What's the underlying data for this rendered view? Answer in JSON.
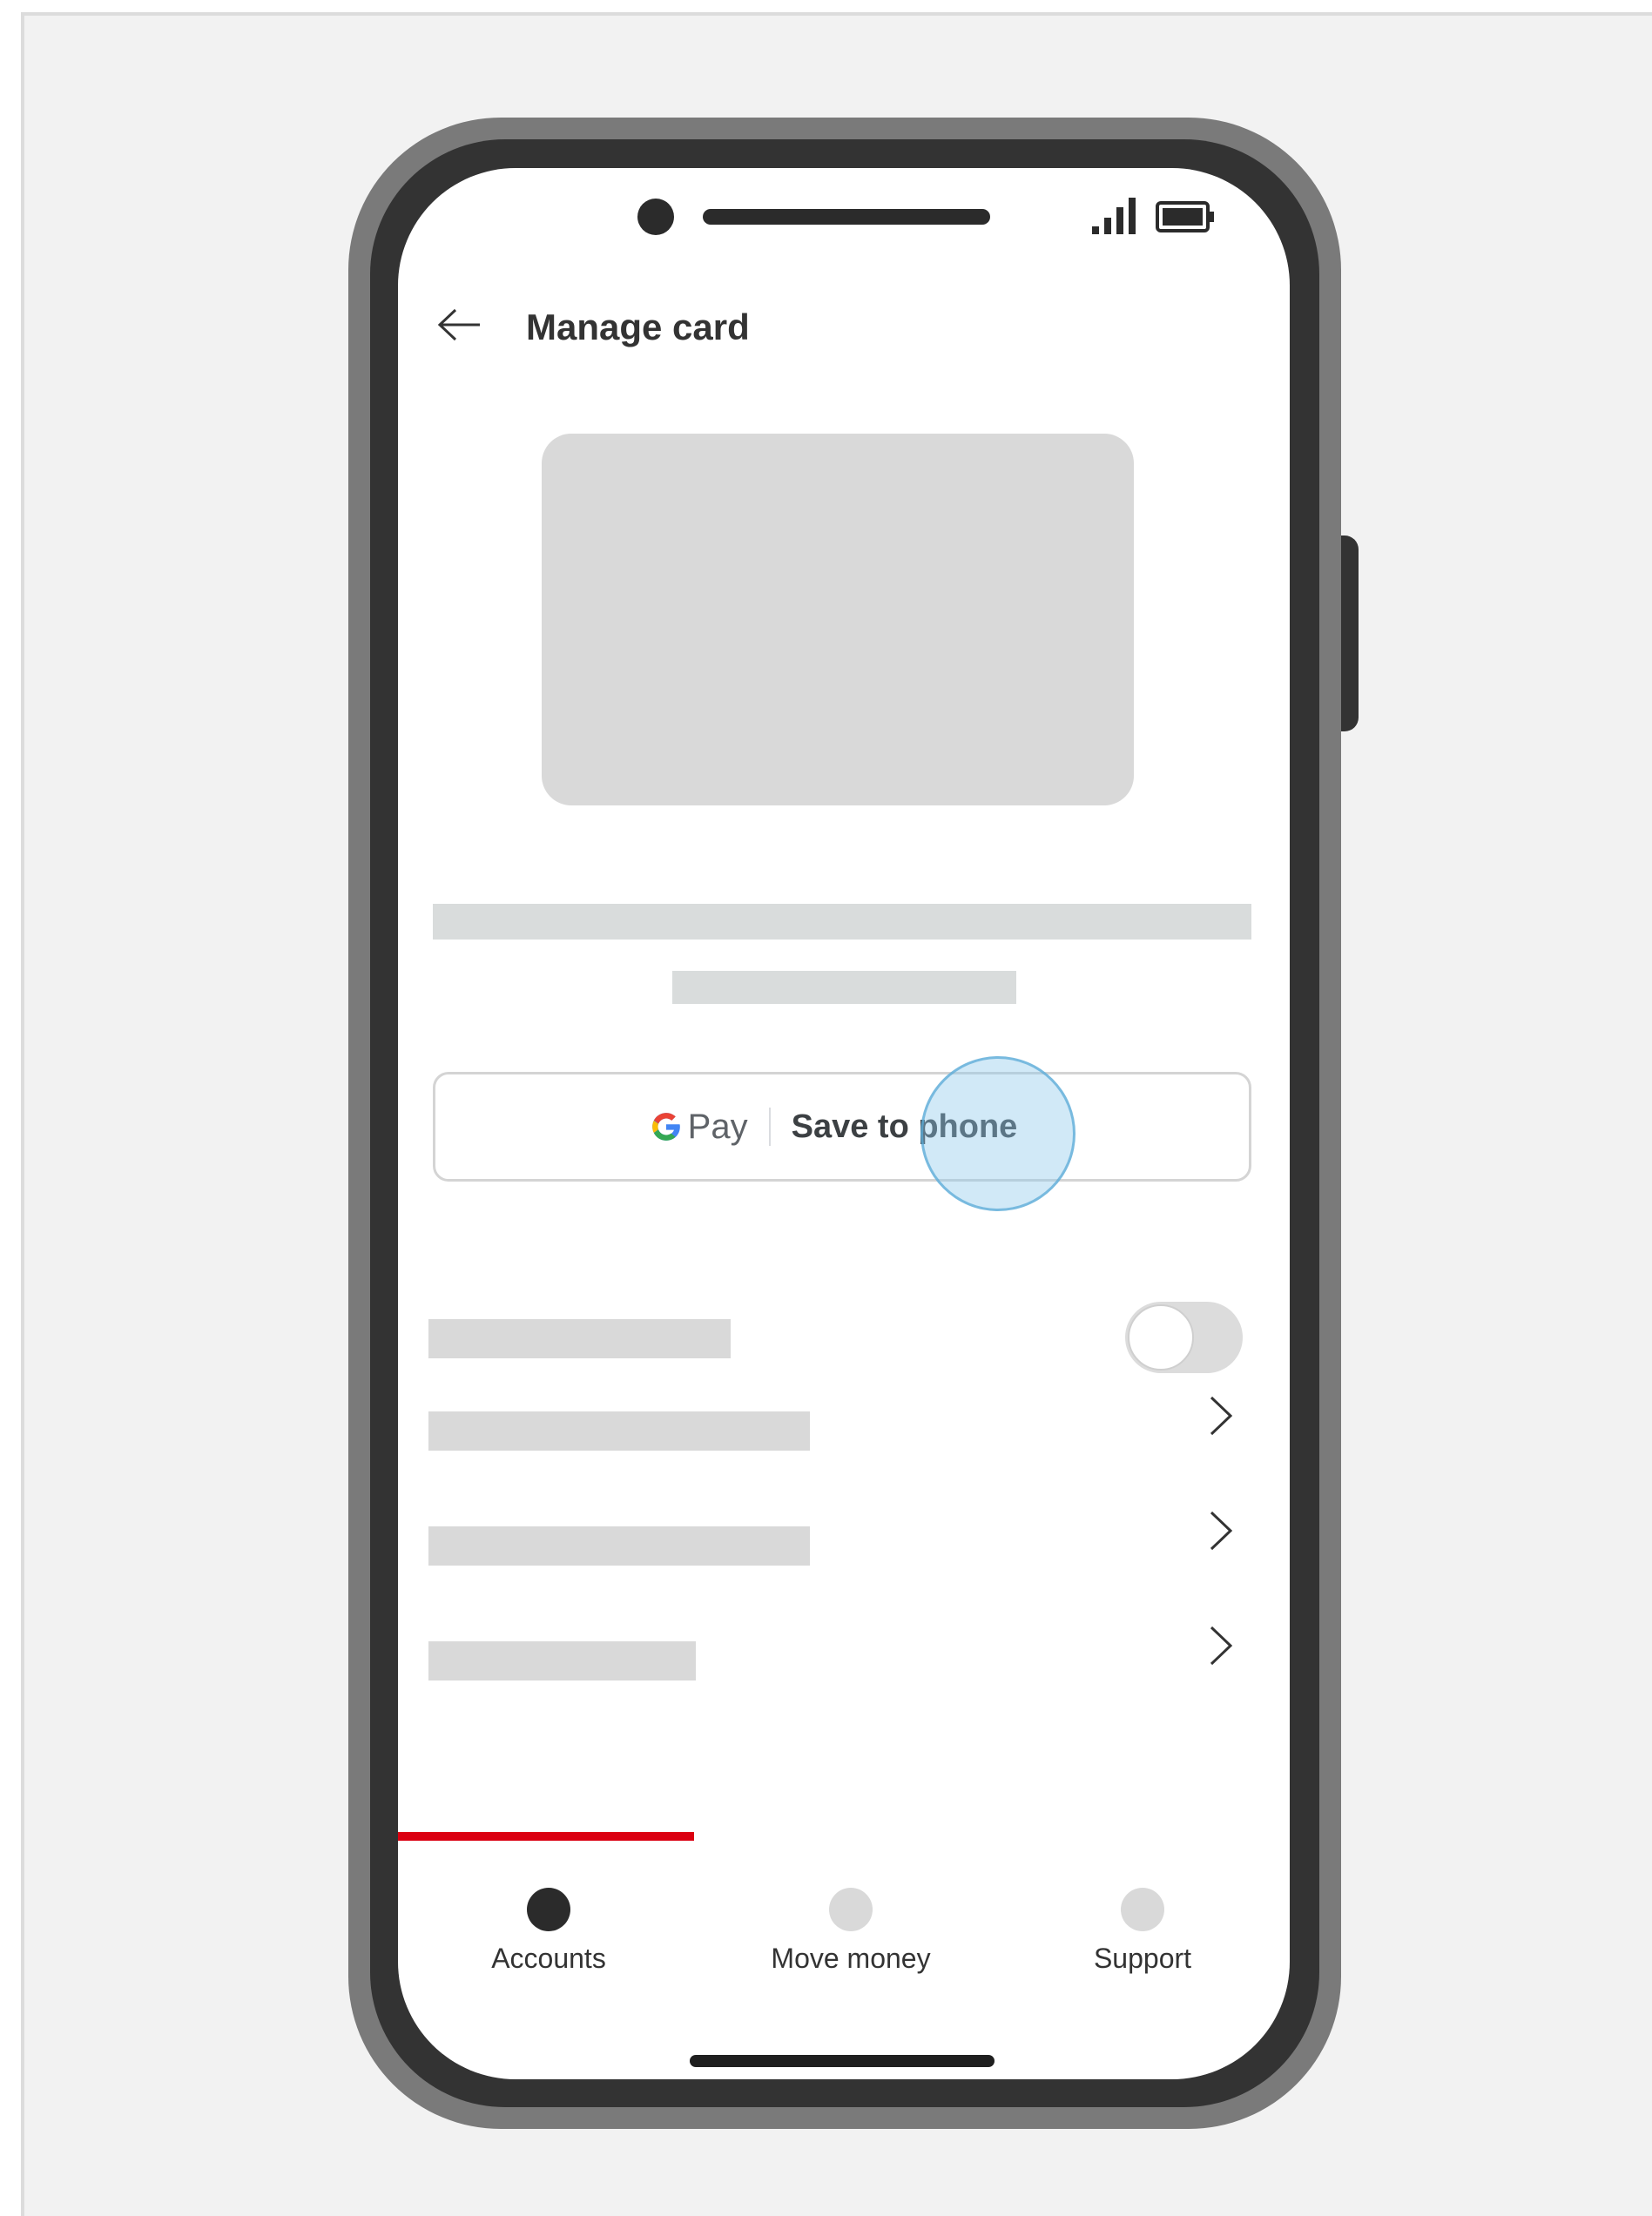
{
  "header": {
    "title": "Manage card",
    "back_icon": "arrow-left-icon"
  },
  "status_bar": {
    "icons": [
      "signal-icon",
      "battery-icon"
    ]
  },
  "gpay_button": {
    "pay_label": "Pay",
    "action_label": "Save to phone",
    "logo_icon": "google-g-icon"
  },
  "settings_rows": [
    {
      "control": "toggle",
      "state": "off"
    },
    {
      "control": "chevron-right-icon"
    },
    {
      "control": "chevron-right-icon"
    },
    {
      "control": "chevron-right-icon"
    }
  ],
  "bottom_nav": {
    "items": [
      {
        "label": "Accounts",
        "active": true
      },
      {
        "label": "Move money",
        "active": false
      },
      {
        "label": "Support",
        "active": false
      }
    ]
  },
  "colors": {
    "accent_red": "#db0011",
    "tap_highlight": "#8cc8eb",
    "phone_frame": "#333333"
  }
}
